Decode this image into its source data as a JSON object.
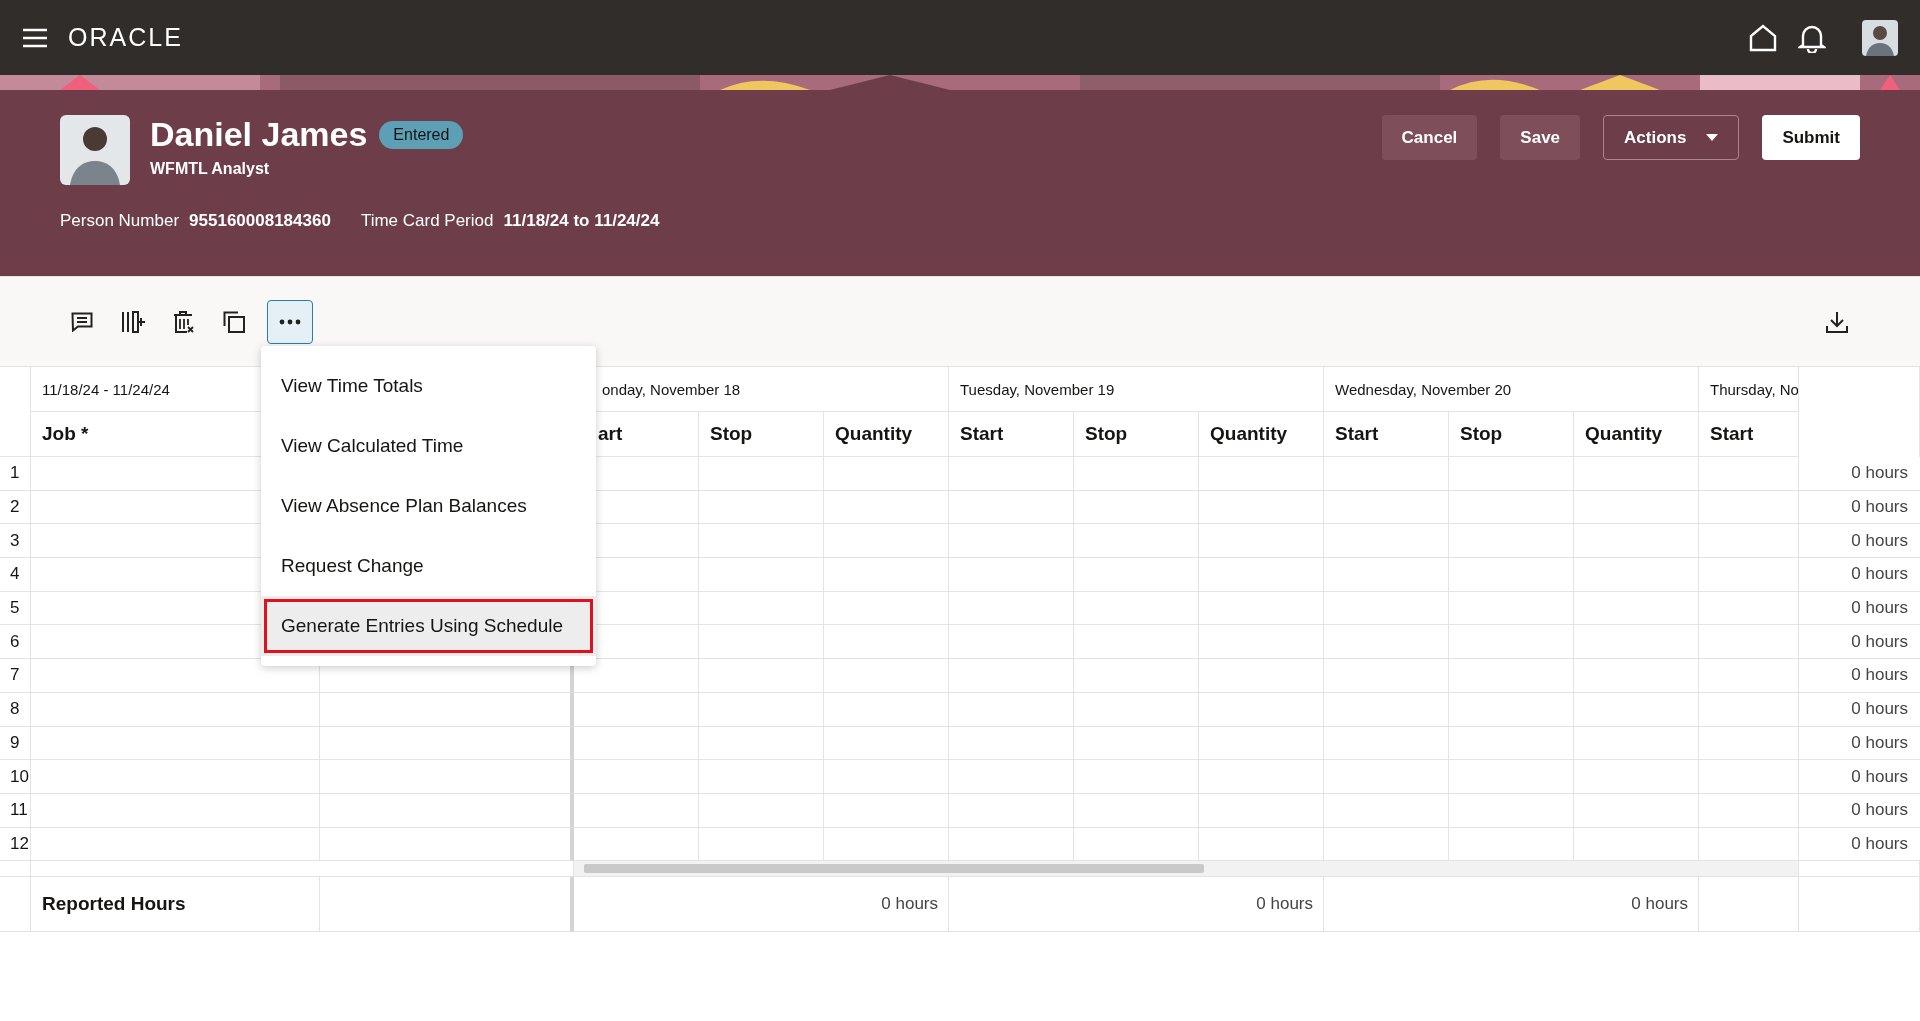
{
  "topbar": {
    "logo": "ORACLE"
  },
  "header": {
    "name": "Daniel James",
    "status": "Entered",
    "role": "WFMTL Analyst",
    "fields": [
      {
        "label": "Person Number",
        "value": "955160008184360"
      },
      {
        "label": "Time Card Period",
        "value": "11/18/24 to 11/24/24"
      }
    ],
    "buttons": [
      {
        "label": "Cancel",
        "kind": "plain"
      },
      {
        "label": "Save",
        "kind": "plain"
      },
      {
        "label": "Actions",
        "kind": "dropdown"
      },
      {
        "label": "Submit",
        "kind": "primary"
      }
    ]
  },
  "toolbar": {
    "more_selected": true
  },
  "menu": {
    "open": true,
    "items": [
      {
        "label": "View Time Totals",
        "selected": false
      },
      {
        "label": "View Calculated Time",
        "selected": false
      },
      {
        "label": "View Absence Plan Balances",
        "selected": false
      },
      {
        "label": "Request Change",
        "selected": false
      },
      {
        "label": "Generate Entries Using Schedule",
        "selected": true
      }
    ]
  },
  "table": {
    "range": "11/18/24 - 11/24/24",
    "job_header": "Job *",
    "days": [
      {
        "label": "onday, November 18",
        "columns": [
          "art",
          "Stop",
          "Quantity"
        ]
      },
      {
        "label": "Tuesday, November 19",
        "columns": [
          "Start",
          "Stop",
          "Quantity"
        ]
      },
      {
        "label": "Wednesday, November 20",
        "columns": [
          "Start",
          "Stop",
          "Quantity"
        ]
      },
      {
        "label": "Thursday, No",
        "columns": [
          "Start"
        ]
      }
    ],
    "rows": [
      {
        "number": "1",
        "total": "0 hours"
      },
      {
        "number": "2",
        "total": "0 hours"
      },
      {
        "number": "3",
        "total": "0 hours"
      },
      {
        "number": "4",
        "total": "0 hours"
      },
      {
        "number": "5",
        "total": "0 hours"
      },
      {
        "number": "6",
        "total": "0 hours"
      },
      {
        "number": "7",
        "total": "0 hours"
      },
      {
        "number": "8",
        "total": "0 hours"
      },
      {
        "number": "9",
        "total": "0 hours"
      },
      {
        "number": "10",
        "total": "0 hours"
      },
      {
        "number": "11",
        "total": "0 hours"
      },
      {
        "number": "12",
        "total": "0 hours"
      }
    ],
    "footer": {
      "label": "Reported Hours",
      "day_totals": [
        "0 hours",
        "0 hours",
        "0 hours"
      ]
    }
  }
}
